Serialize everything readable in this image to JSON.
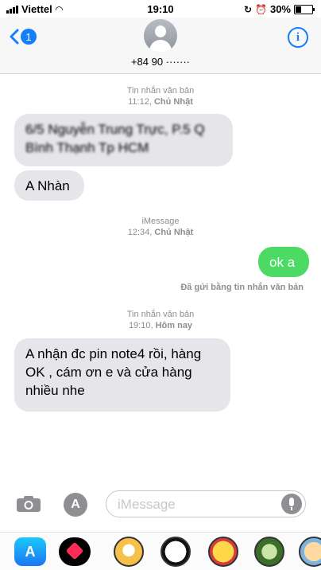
{
  "status_bar": {
    "carrier": "Viettel",
    "time": "19:10",
    "battery": "30%",
    "battery_level": 0.3
  },
  "header": {
    "back_count": "1",
    "contact_number": "+84 90 ·······",
    "info_label": "i"
  },
  "messages": [
    {
      "type": "timestamp",
      "label": "Tin nhắn văn bản",
      "time": "11:12",
      "day": "Chủ Nhật"
    },
    {
      "type": "received",
      "text_line1": "6/5 Nguyễn Trung Trực, P.5 Q",
      "text_line2": "Bình Thạnh Tp HCM",
      "obscured": true
    },
    {
      "type": "received",
      "text": "A Nhàn"
    },
    {
      "type": "timestamp",
      "label": "iMessage",
      "time": "12:34",
      "day": "Chủ Nhật"
    },
    {
      "type": "sent",
      "text": "ok a"
    },
    {
      "type": "sent_note",
      "text": "Đã gửi bằng tin nhắn văn bản"
    },
    {
      "type": "timestamp",
      "label": "Tin nhắn văn bản",
      "time": "19:10",
      "day": "Hôm nay"
    },
    {
      "type": "received",
      "text_line1": "A nhận đc pin note4 rồi, hàng",
      "text_line2": "OK , cám ơn e và cửa hàng",
      "text_line3": "nhiều nhe"
    }
  ],
  "composer": {
    "placeholder": "iMessage"
  },
  "app_drawer": [
    "app-store",
    "digital-touch",
    "sticker-girl",
    "sticker-panda",
    "sticker-boy",
    "sticker-cap",
    "sticker-kid"
  ],
  "colors": {
    "accent": "#147efb",
    "received_bubble": "#e5e5ea",
    "sent_bubble_sms": "#4cd964"
  }
}
